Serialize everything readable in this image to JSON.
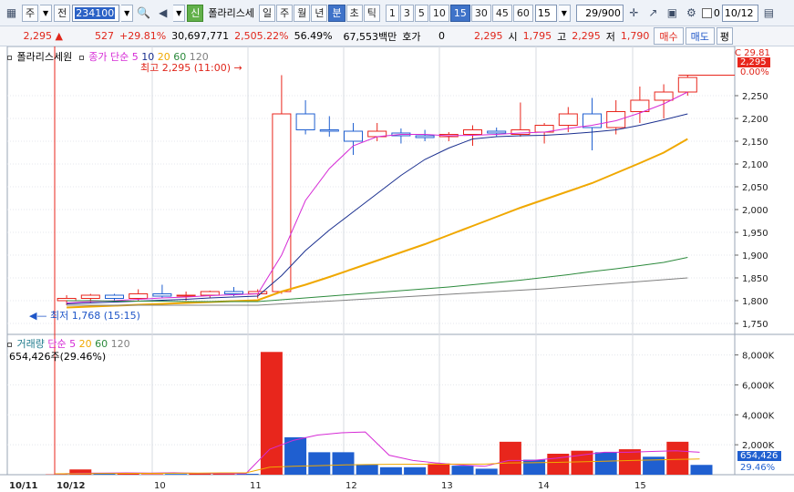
{
  "toolbar": {
    "type_button": "주",
    "scope_button": "전",
    "code_value": "234100",
    "zoom_icon": "magnifier",
    "credit_badge": "신",
    "stock_name": "폴라리스세",
    "period_tabs": [
      "일",
      "주",
      "월",
      "년",
      "분",
      "초",
      "틱"
    ],
    "period_selected": "분",
    "minute_tabs": [
      "1",
      "3",
      "5",
      "10",
      "15",
      "30",
      "45",
      "60"
    ],
    "minute_selected": "15",
    "minute_select_value": "15",
    "count_value": "29/900",
    "date_value": "10/12",
    "checkbox_label": "0"
  },
  "info": {
    "price": "2,295",
    "change": "527",
    "change_pct": "+29.81%",
    "volume": "30,697,771",
    "volume_pct": "2,505.22%",
    "turnover_pct": "56.49%",
    "amount": "67,553백만",
    "quote_label": "호가",
    "quote_value": "0",
    "last": "2,295",
    "open_label": "시",
    "open_value": "1,795",
    "high_label": "고",
    "high_value": "2,295",
    "low_label": "저",
    "low_value": "1,790",
    "buy_button": "매수",
    "sell_button": "매도",
    "eval_button": "평"
  },
  "price_legend": {
    "name": "폴라리스세원",
    "ma_label": "종가 단순",
    "periods": [
      "5",
      "10",
      "20",
      "60",
      "120"
    ],
    "max_annotation": "최고 2,295 (11:00)",
    "min_annotation": "최저 1,768 (15:15)",
    "right_top_label": "29.81",
    "right_current_price": "2,295",
    "right_pct": "0.00%"
  },
  "volume_legend": {
    "name": "거래량",
    "ma_label": "단순",
    "periods": [
      "5",
      "20",
      "60",
      "120"
    ],
    "value_line": "654,426주(29.46%)",
    "right_current_volume": "654,426",
    "right_pct": "29.46%"
  },
  "colors": {
    "up": "#e8261c",
    "down": "#1f5fd0",
    "ma5": "#d62bd6",
    "ma10": "#1a2f8f",
    "ma20": "#f0a800",
    "ma60": "#2c8a3c",
    "ma120": "#808080"
  },
  "chart_data": [
    {
      "type": "candlestick",
      "title": "폴라리스세원 15분",
      "x_tick_labels": [
        "10/11",
        "10/12",
        "10",
        "11",
        "12",
        "13",
        "14",
        "15"
      ],
      "y_ticks": [
        1750,
        1800,
        1850,
        1900,
        1950,
        2000,
        2050,
        2100,
        2150,
        2200,
        2250
      ],
      "ylim": [
        1730,
        2330
      ],
      "bars": [
        {
          "o": 1800,
          "h": 1812,
          "l": 1790,
          "c": 1805
        },
        {
          "o": 1805,
          "h": 1815,
          "l": 1795,
          "c": 1812
        },
        {
          "o": 1812,
          "h": 1815,
          "l": 1800,
          "c": 1805
        },
        {
          "o": 1805,
          "h": 1825,
          "l": 1800,
          "c": 1815
        },
        {
          "o": 1815,
          "h": 1835,
          "l": 1805,
          "c": 1810
        },
        {
          "o": 1810,
          "h": 1820,
          "l": 1800,
          "c": 1812
        },
        {
          "o": 1812,
          "h": 1822,
          "l": 1805,
          "c": 1820
        },
        {
          "o": 1820,
          "h": 1830,
          "l": 1810,
          "c": 1815
        },
        {
          "o": 1815,
          "h": 1825,
          "l": 1805,
          "c": 1820
        },
        {
          "o": 1820,
          "h": 2295,
          "l": 1815,
          "c": 2210
        },
        {
          "o": 2210,
          "h": 2240,
          "l": 2165,
          "c": 2175
        },
        {
          "o": 2175,
          "h": 2205,
          "l": 2160,
          "c": 2172
        },
        {
          "o": 2172,
          "h": 2190,
          "l": 2120,
          "c": 2150
        },
        {
          "o": 2160,
          "h": 2190,
          "l": 2150,
          "c": 2172
        },
        {
          "o": 2168,
          "h": 2178,
          "l": 2145,
          "c": 2162
        },
        {
          "o": 2162,
          "h": 2175,
          "l": 2150,
          "c": 2158
        },
        {
          "o": 2160,
          "h": 2170,
          "l": 2150,
          "c": 2165
        },
        {
          "o": 2165,
          "h": 2185,
          "l": 2140,
          "c": 2175
        },
        {
          "o": 2172,
          "h": 2180,
          "l": 2160,
          "c": 2168
        },
        {
          "o": 2165,
          "h": 2235,
          "l": 2160,
          "c": 2175
        },
        {
          "o": 2170,
          "h": 2190,
          "l": 2145,
          "c": 2185
        },
        {
          "o": 2185,
          "h": 2225,
          "l": 2170,
          "c": 2210
        },
        {
          "o": 2210,
          "h": 2245,
          "l": 2130,
          "c": 2180
        },
        {
          "o": 2180,
          "h": 2240,
          "l": 2165,
          "c": 2215
        },
        {
          "o": 2215,
          "h": 2270,
          "l": 2190,
          "c": 2240
        },
        {
          "o": 2240,
          "h": 2275,
          "l": 2200,
          "c": 2258
        },
        {
          "o": 2258,
          "h": 2295,
          "l": 2250,
          "c": 2290
        }
      ],
      "series": [
        {
          "name": "5",
          "values": [
            1795,
            1798,
            1800,
            1803,
            1806,
            1808,
            1811,
            1813,
            1815,
            1900,
            2020,
            2090,
            2140,
            2160,
            2165,
            2165,
            2162,
            2163,
            2165,
            2168,
            2170,
            2178,
            2185,
            2195,
            2212,
            2232,
            2258
          ]
        },
        {
          "name": "10",
          "values": [
            1793,
            1795,
            1797,
            1799,
            1801,
            1803,
            1806,
            1808,
            1810,
            1855,
            1910,
            1955,
            1995,
            2035,
            2075,
            2110,
            2135,
            2155,
            2160,
            2162,
            2163,
            2166,
            2170,
            2175,
            2185,
            2197,
            2210
          ]
        },
        {
          "name": "20",
          "values": [
            1785,
            1787,
            1789,
            1791,
            1793,
            1795,
            1797,
            1799,
            1801,
            1820,
            1835,
            1852,
            1870,
            1888,
            1906,
            1924,
            1944,
            1964,
            1984,
            2004,
            2022,
            2040,
            2058,
            2080,
            2102,
            2125,
            2155
          ]
        },
        {
          "name": "60",
          "values": [
            1800,
            1800,
            1799,
            1799,
            1799,
            1798,
            1798,
            1798,
            1798,
            1802,
            1806,
            1810,
            1814,
            1818,
            1822,
            1826,
            1830,
            1835,
            1840,
            1845,
            1851,
            1857,
            1864,
            1870,
            1877,
            1884,
            1895
          ]
        },
        {
          "name": "120",
          "values": [
            1790,
            1790,
            1790,
            1790,
            1790,
            1790,
            1790,
            1790,
            1790,
            1793,
            1796,
            1799,
            1802,
            1805,
            1808,
            1811,
            1814,
            1817,
            1820,
            1823,
            1826,
            1830,
            1834,
            1838,
            1842,
            1846,
            1850
          ]
        }
      ]
    },
    {
      "type": "bar",
      "title": "거래량",
      "y_tick_labels": [
        "2,000K",
        "4,000K",
        "6,000K",
        "8,000K"
      ],
      "ylim": [
        0,
        8400
      ],
      "unit": "K",
      "values": [
        20,
        350,
        60,
        80,
        40,
        50,
        80,
        90,
        60,
        8200,
        2500,
        1500,
        1500,
        700,
        500,
        500,
        750,
        600,
        400,
        2200,
        1000,
        1400,
        1600,
        1500,
        1700,
        1200,
        2200,
        654
      ],
      "directions": [
        "u",
        "u",
        "d",
        "u",
        "u",
        "d",
        "u",
        "u",
        "d",
        "u",
        "d",
        "d",
        "d",
        "d",
        "d",
        "d",
        "u",
        "d",
        "d",
        "u",
        "d",
        "u",
        "u",
        "d",
        "u",
        "d",
        "u",
        "d"
      ],
      "series": [
        {
          "name": "5",
          "values": [
            40,
            100,
            110,
            120,
            110,
            130,
            90,
            80,
            70,
            1700,
            2300,
            2650,
            2800,
            2850,
            1300,
            950,
            780,
            650,
            560,
            950,
            950,
            1100,
            1300,
            1500,
            1500,
            1550,
            1600,
            1500
          ]
        },
        {
          "name": "20",
          "values": [
            60,
            70,
            80,
            90,
            95,
            100,
            110,
            120,
            125,
            500,
            560,
            600,
            650,
            680,
            690,
            700,
            700,
            705,
            710,
            780,
            800,
            820,
            860,
            900,
            940,
            980,
            1020,
            1050
          ]
        }
      ]
    }
  ]
}
